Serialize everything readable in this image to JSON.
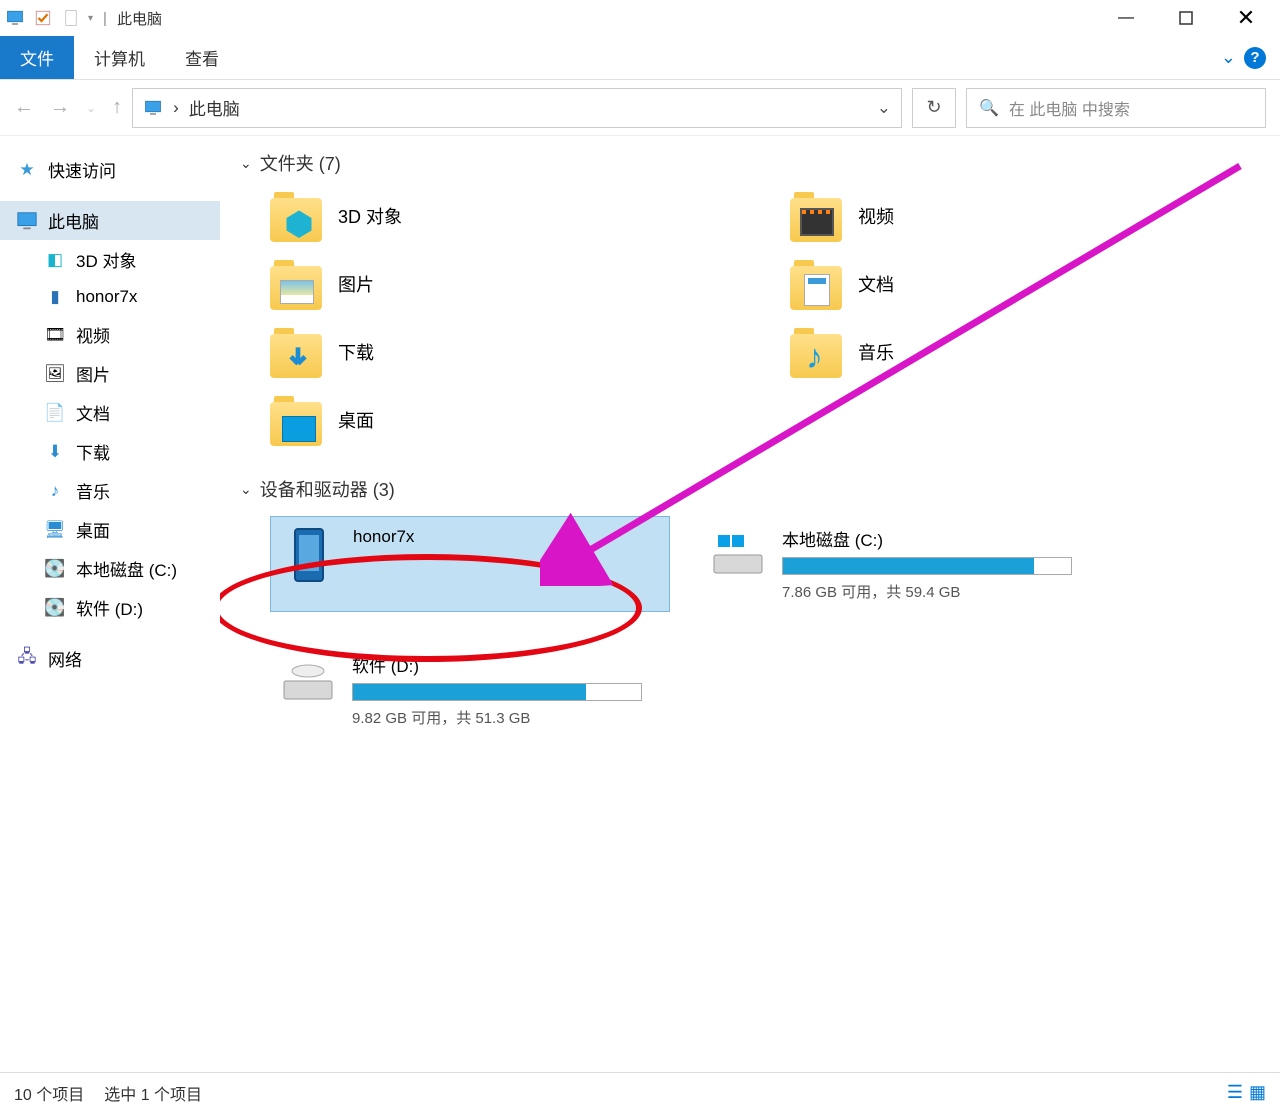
{
  "titlebar": {
    "title": "此电脑",
    "sep": "|"
  },
  "menubar": {
    "file": "文件",
    "computer": "计算机",
    "view": "查看",
    "chev": "⌄"
  },
  "navbar": {
    "breadcrumb_arrow": "›",
    "breadcrumb": "此电脑",
    "search_placeholder": "在 此电脑 中搜索"
  },
  "sidebar": {
    "quick_access": "快速访问",
    "this_pc": "此电脑",
    "items": [
      {
        "label": "3D 对象"
      },
      {
        "label": "honor7x"
      },
      {
        "label": "视频"
      },
      {
        "label": "图片"
      },
      {
        "label": "文档"
      },
      {
        "label": "下载"
      },
      {
        "label": "音乐"
      },
      {
        "label": "桌面"
      },
      {
        "label": "本地磁盘 (C:)"
      },
      {
        "label": "软件 (D:)"
      }
    ],
    "network": "网络"
  },
  "main": {
    "folders_header": "文件夹 (7)",
    "devices_header": "设备和驱动器 (3)",
    "folders": [
      {
        "label": "3D 对象"
      },
      {
        "label": "视频"
      },
      {
        "label": "图片"
      },
      {
        "label": "文档"
      },
      {
        "label": "下载"
      },
      {
        "label": "音乐"
      },
      {
        "label": "桌面"
      }
    ],
    "devices": {
      "phone": {
        "label": "honor7x"
      },
      "c": {
        "label": "本地磁盘 (C:)",
        "sub": "7.86 GB 可用，共 59.4 GB",
        "fill": 87
      },
      "d": {
        "label": "软件 (D:)",
        "sub": "9.82 GB 可用，共 51.3 GB",
        "fill": 81
      }
    }
  },
  "statusbar": {
    "count": "10 个项目",
    "selected": "选中 1 个项目"
  }
}
